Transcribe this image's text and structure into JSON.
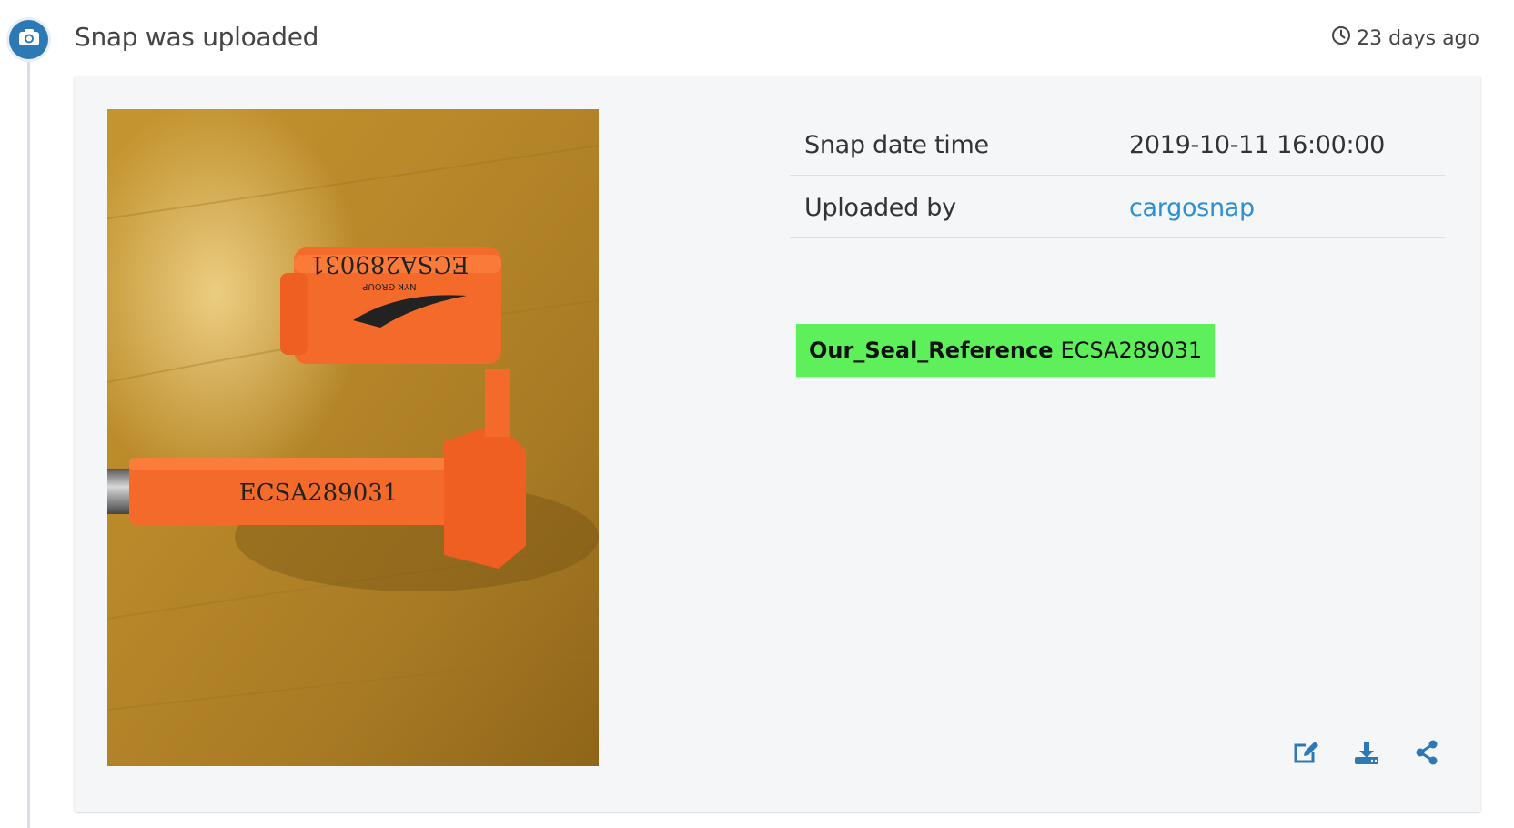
{
  "event": {
    "title": "Snap was uploaded",
    "icon": "camera-icon",
    "timestamp": "23 days ago",
    "timestamp_icon": "clock-icon"
  },
  "details": [
    {
      "label": "Snap date time",
      "value": "2019-10-11 16:00:00",
      "is_link": false
    },
    {
      "label": "Uploaded by",
      "value": "cargosnap",
      "is_link": true
    }
  ],
  "tag": {
    "key": "Our_Seal_Reference",
    "value": "ECSA289031",
    "color": "#5ef05a"
  },
  "photo": {
    "description_icon": "photo-thumbnail",
    "seal_text": "ECSA289031",
    "cap_text": "ECSA289031",
    "cap_brand": "NYK GROUP"
  },
  "actions": [
    {
      "name": "edit-icon"
    },
    {
      "name": "download-icon"
    },
    {
      "name": "share-icon"
    }
  ],
  "colors": {
    "accent": "#2d79b5",
    "link": "#2d8fd5",
    "seal": "#f46a2a"
  }
}
